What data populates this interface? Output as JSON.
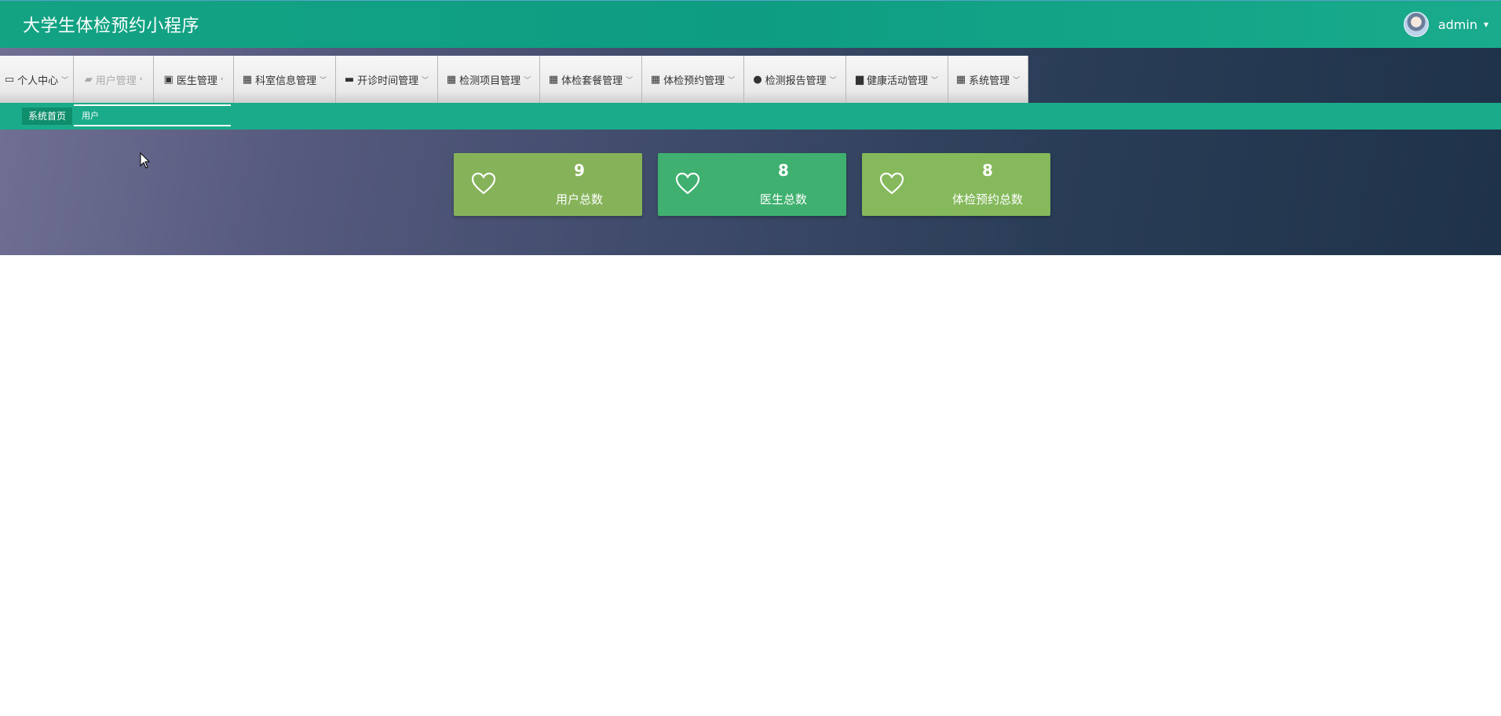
{
  "header": {
    "app_title": "大学生体检预约小程序",
    "username": "admin",
    "caret": "▾"
  },
  "nav": {
    "items": [
      {
        "label": "个人中心",
        "icon": "id-card-icon"
      },
      {
        "label": "用户管理",
        "icon": "chat-icon"
      },
      {
        "label": "医生管理",
        "icon": "clipboard-icon"
      },
      {
        "label": "科室信息管理",
        "icon": "grid-icon"
      },
      {
        "label": "开诊时间管理",
        "icon": "comment-icon"
      },
      {
        "label": "检测项目管理",
        "icon": "grid-icon"
      },
      {
        "label": "体检套餐管理",
        "icon": "grid-icon"
      },
      {
        "label": "体检预约管理",
        "icon": "grid-icon"
      },
      {
        "label": "检测报告管理",
        "icon": "user-icon"
      },
      {
        "label": "健康活动管理",
        "icon": "inbox-icon"
      },
      {
        "label": "系统管理",
        "icon": "grid-icon"
      }
    ]
  },
  "breadcrumb": {
    "home": "系统首页",
    "active": "用户"
  },
  "stats": [
    {
      "value": "9",
      "label": "用户总数",
      "color": "#86b35a"
    },
    {
      "value": "8",
      "label": "医生总数",
      "color": "#3fb06f"
    },
    {
      "value": "8",
      "label": "体检预约总数",
      "color": "#85b95b"
    }
  ]
}
